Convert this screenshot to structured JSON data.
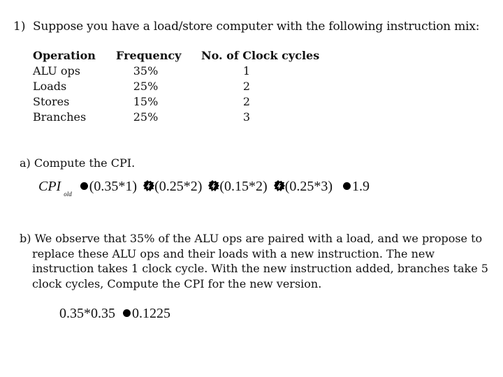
{
  "question": {
    "number": "1)",
    "intro": "Suppose you have a load/store computer with the following instruction mix:"
  },
  "table": {
    "headers": [
      "Operation",
      "Frequency",
      "No. of Clock cycles"
    ],
    "rows": [
      [
        "ALU ops",
        "35%",
        "1"
      ],
      [
        "Loads",
        "25%",
        "2"
      ],
      [
        "Stores",
        "15%",
        "2"
      ],
      [
        "Branches",
        "25%",
        "3"
      ]
    ]
  },
  "part_a": {
    "label": "a) Compute the CPI.",
    "equation": {
      "lhs": "CPI",
      "lhs_subscript": "old",
      "terms": [
        "(0.35*1)",
        "(0.25*2)",
        "(0.15*2)",
        "(0.25*3)"
      ],
      "result": "1.9"
    }
  },
  "part_b": {
    "lines": [
      "b) We observe that 35% of the ALU ops are paired with a load, and we propose to",
      "replace these ALU ops and their loads with a new instruction. The new",
      "instruction takes 1 clock cycle. With the new instruction added, branches take 5",
      "clock cycles, Compute the CPI for the new version."
    ],
    "equation": {
      "lhs": "0.35*0.35",
      "result": "0.1225"
    }
  },
  "glyphs": {
    "equals_symbol": "filled-circle",
    "plus_symbol": "burst-glyph"
  }
}
